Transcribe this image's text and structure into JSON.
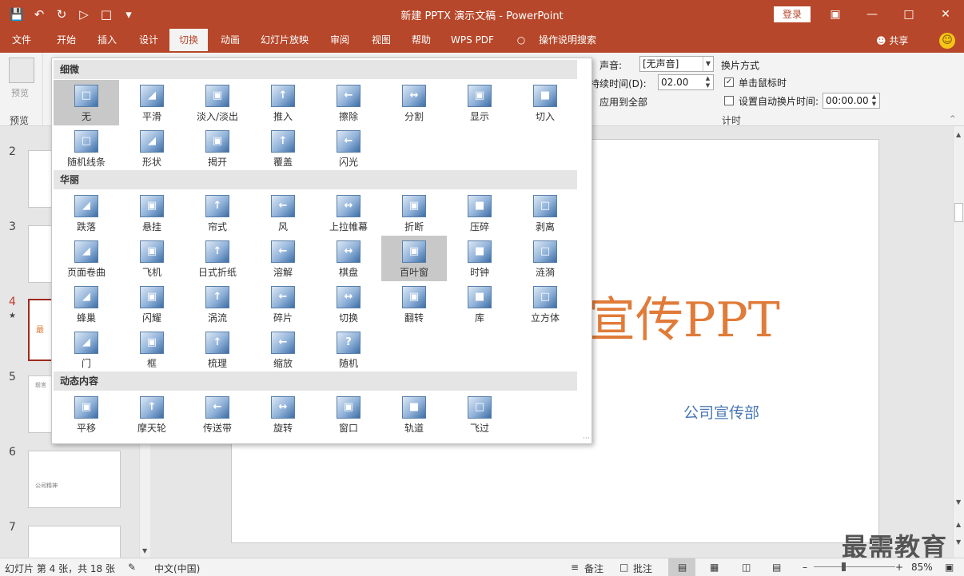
{
  "window": {
    "title": "新建 PPTX 演示文稿 - PowerPoint",
    "login": "登录",
    "qat_icons": [
      "save-icon",
      "undo-icon",
      "redo-icon",
      "present-icon",
      "new-icon",
      "more-icon"
    ]
  },
  "tabs": [
    "文件",
    "开始",
    "插入",
    "设计",
    "切换",
    "动画",
    "幻灯片放映",
    "审阅",
    "视图",
    "帮助",
    "WPS PDF",
    "操作说明搜索"
  ],
  "active_tab": "切换",
  "share": "共享",
  "ribbon": {
    "preview_label": "预览",
    "preview_group": "预览",
    "sound_label": "声音:",
    "sound_value": "[无声音]",
    "duration_label": "持续时间(D):",
    "duration_value": "02.00",
    "apply_all": "应用到全部",
    "advance_title": "换片方式",
    "on_click": "单击鼠标时",
    "auto_after": "设置自动换片时间:",
    "auto_time": "00:00.00",
    "timing_group": "计时"
  },
  "thumbnails": [
    {
      "num": "2",
      "text": ""
    },
    {
      "num": "3",
      "text": ""
    },
    {
      "num": "4",
      "text": "最"
    },
    {
      "num": "5",
      "text": "前言"
    },
    {
      "num": "6",
      "text": "公司精神"
    },
    {
      "num": "7",
      "text": ""
    }
  ],
  "slide": {
    "title": "宣传PPT",
    "subtitle": "公司宣传部"
  },
  "watermark": "最需教育",
  "gallery": {
    "sections": [
      {
        "title": "细微",
        "items": [
          "无",
          "平滑",
          "淡入/淡出",
          "推入",
          "擦除",
          "分割",
          "显示",
          "切入",
          "随机线条",
          "形状",
          "揭开",
          "覆盖",
          "闪光"
        ]
      },
      {
        "title": "华丽",
        "items": [
          "跌落",
          "悬挂",
          "帘式",
          "风",
          "上拉帷幕",
          "折断",
          "压碎",
          "剥离",
          "页面卷曲",
          "飞机",
          "日式折纸",
          "溶解",
          "棋盘",
          "百叶窗",
          "时钟",
          "涟漪",
          "蜂巢",
          "闪耀",
          "涡流",
          "碎片",
          "切换",
          "翻转",
          "库",
          "立方体",
          "门",
          "框",
          "梳理",
          "缩放",
          "随机"
        ]
      },
      {
        "title": "动态内容",
        "items": [
          "平移",
          "摩天轮",
          "传送带",
          "旋转",
          "窗口",
          "轨道",
          "飞过"
        ]
      }
    ],
    "selected": [
      "无",
      "百叶窗"
    ]
  },
  "status": {
    "slide_info": "幻灯片 第 4 张，共 18 张",
    "language": "中文(中国)",
    "notes": "备注",
    "comments": "批注",
    "zoom": "85%"
  }
}
